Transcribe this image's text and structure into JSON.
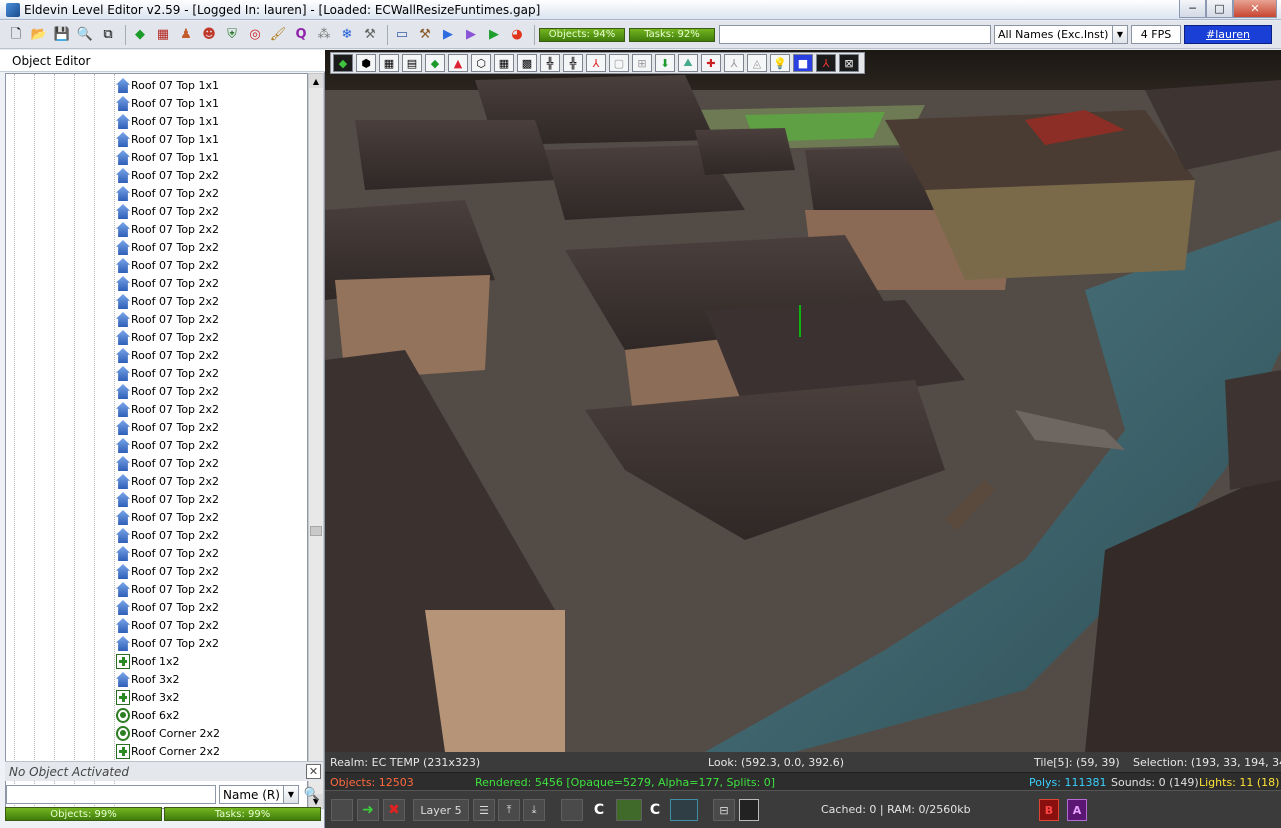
{
  "window": {
    "title": "Eldevin Level Editor v2.59 - [Logged In: lauren] - [Loaded: ECWallResizeFuntimes.gap]",
    "minimize": "─",
    "maximize": "□",
    "close": "✕"
  },
  "toolbar": {
    "objects_meter": "Objects: 94%",
    "tasks_meter": "Tasks: 92%",
    "search_value": "",
    "name_filter": "All Names (Exc.Inst)",
    "fps": "4 FPS",
    "channel": "#lauren"
  },
  "left_panel": {
    "title": "Object Editor",
    "tree_items": [
      {
        "label": "Roof 07 Top 1x1",
        "icon": "roof-icon"
      },
      {
        "label": "Roof 07 Top 1x1",
        "icon": "roof-icon"
      },
      {
        "label": "Roof 07 Top 1x1",
        "icon": "roof-icon"
      },
      {
        "label": "Roof 07 Top 1x1",
        "icon": "roof-icon"
      },
      {
        "label": "Roof 07 Top 1x1",
        "icon": "roof-icon"
      },
      {
        "label": "Roof 07 Top 2x2",
        "icon": "roof-icon"
      },
      {
        "label": "Roof 07 Top 2x2",
        "icon": "roof-icon"
      },
      {
        "label": "Roof 07 Top 2x2",
        "icon": "roof-icon"
      },
      {
        "label": "Roof 07 Top 2x2",
        "icon": "roof-icon"
      },
      {
        "label": "Roof 07 Top 2x2",
        "icon": "roof-icon"
      },
      {
        "label": "Roof 07 Top 2x2",
        "icon": "roof-icon"
      },
      {
        "label": "Roof 07 Top 2x2",
        "icon": "roof-icon"
      },
      {
        "label": "Roof 07 Top 2x2",
        "icon": "roof-icon"
      },
      {
        "label": "Roof 07 Top 2x2",
        "icon": "roof-icon"
      },
      {
        "label": "Roof 07 Top 2x2",
        "icon": "roof-icon"
      },
      {
        "label": "Roof 07 Top 2x2",
        "icon": "roof-icon"
      },
      {
        "label": "Roof 07 Top 2x2",
        "icon": "roof-icon"
      },
      {
        "label": "Roof 07 Top 2x2",
        "icon": "roof-icon"
      },
      {
        "label": "Roof 07 Top 2x2",
        "icon": "roof-icon"
      },
      {
        "label": "Roof 07 Top 2x2",
        "icon": "roof-icon"
      },
      {
        "label": "Roof 07 Top 2x2",
        "icon": "roof-icon"
      },
      {
        "label": "Roof 07 Top 2x2",
        "icon": "roof-icon"
      },
      {
        "label": "Roof 07 Top 2x2",
        "icon": "roof-icon"
      },
      {
        "label": "Roof 07 Top 2x2",
        "icon": "roof-icon"
      },
      {
        "label": "Roof 07 Top 2x2",
        "icon": "roof-icon"
      },
      {
        "label": "Roof 07 Top 2x2",
        "icon": "roof-icon"
      },
      {
        "label": "Roof 07 Top 2x2",
        "icon": "roof-icon"
      },
      {
        "label": "Roof 07 Top 2x2",
        "icon": "roof-icon"
      },
      {
        "label": "Roof 07 Top 2x2",
        "icon": "roof-icon"
      },
      {
        "label": "Roof 07 Top 2x2",
        "icon": "roof-icon"
      },
      {
        "label": "Roof 07 Top 2x2",
        "icon": "roof-icon"
      },
      {
        "label": "Roof 07 Top 2x2",
        "icon": "roof-icon"
      },
      {
        "label": "Roof 1x2",
        "icon": "expand-plus-icon"
      },
      {
        "label": "Roof 3x2",
        "icon": "roof-icon"
      },
      {
        "label": "Roof 3x2",
        "icon": "expand-plus-icon"
      },
      {
        "label": "Roof 6x2",
        "icon": "target-dot-icon"
      },
      {
        "label": "Roof Corner 2x2",
        "icon": "target-dot-icon"
      },
      {
        "label": "Roof Corner 2x2",
        "icon": "expand-plus-icon"
      },
      {
        "label": "Roof Corner 2x2",
        "icon": "expand-plus-icon"
      }
    ],
    "activated": "No Object Activated",
    "object_search_value": "",
    "sort_value": "Name (R)",
    "objects_meter": "Objects: 99%",
    "tasks_meter": "Tasks: 99%"
  },
  "status": {
    "realm": "Realm: EC TEMP (231x323)",
    "look": "Look: (592.3, 0.0, 392.6)",
    "tile": "Tile[5]: (59, 39)",
    "selection": "Selection: (193, 33, 194, 34)",
    "objects": "Objects: 12503",
    "rendered": "Rendered: 5456 [Opaque=5279, Alpha=177, Splits: 0]",
    "polys": "Polys: 111381",
    "sounds": "Sounds: 0 (149)",
    "lights": "Lights: 11 (18)"
  },
  "bottom": {
    "layer": "Layer 5",
    "c1": "C",
    "c2": "C",
    "cached": "Cached: 0 | RAM: 0/2560kb",
    "b_button": "B",
    "a_button": "A"
  },
  "colors": {
    "objects_status": "#ff6a3d",
    "rendered_status": "#3ee33e",
    "polys_status": "#39d0ff",
    "sounds_status": "#e0e0e0",
    "lights_status": "#ffe135",
    "channel_bg": "#1a3fd6"
  }
}
